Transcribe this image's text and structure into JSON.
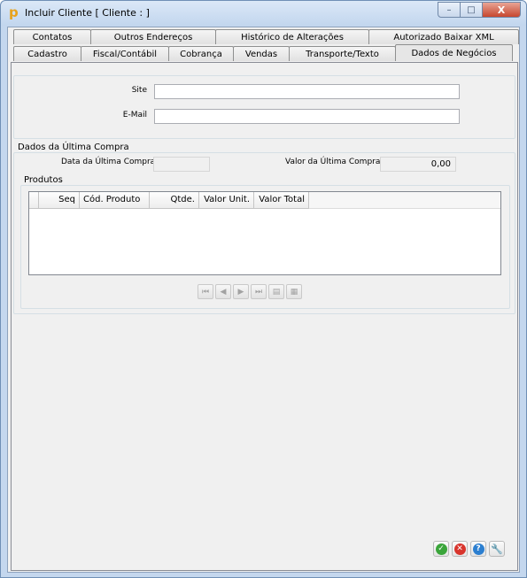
{
  "window": {
    "title": "Incluir Cliente [ Cliente : ]",
    "icon": "app-p-icon",
    "controls": {
      "minimize": "–",
      "maximize": "□",
      "close": "X"
    }
  },
  "tabs": {
    "row_top": [
      {
        "label": "Contatos"
      },
      {
        "label": "Outros Endereços"
      },
      {
        "label": "Histórico de Alterações"
      },
      {
        "label": "Autorizado Baixar XML"
      }
    ],
    "row_bottom": [
      {
        "label": "Cadastro"
      },
      {
        "label": "Fiscal/Contábil"
      },
      {
        "label": "Cobrança"
      },
      {
        "label": "Vendas"
      },
      {
        "label": "Transporte/Texto"
      },
      {
        "label": "Dados de Negócios",
        "active": true
      }
    ]
  },
  "form": {
    "site_label": "Site",
    "site_value": "",
    "email_label": "E-Mail",
    "email_value": ""
  },
  "last_purchase": {
    "section_title": "Dados da Última Compra",
    "date_label": "Data da Última Compra",
    "date_value": "",
    "value_label": "Valor da Última Compra",
    "value_value": "0,00",
    "products_title": "Produtos",
    "columns": [
      "Seq",
      "Cód. Produto",
      "Qtde.",
      "Valor Unit.",
      "Valor Total"
    ],
    "rows": []
  },
  "navigator": {
    "buttons": [
      "first-icon",
      "prior-icon",
      "next-icon",
      "last-icon",
      "edit-icon",
      "refresh-icon"
    ],
    "glyphs": [
      "⏮",
      "◀",
      "▶",
      "⏭",
      "▤",
      "▦"
    ]
  },
  "actions": [
    {
      "name": "confirm-button",
      "icon": "check-icon",
      "glyph": "✓",
      "color": "#3aa53a"
    },
    {
      "name": "cancel-button",
      "icon": "cancel-icon",
      "glyph": "✕",
      "color": "#d8342c"
    },
    {
      "name": "help-button",
      "icon": "help-icon",
      "glyph": "?",
      "color": "#2c7fd0"
    },
    {
      "name": "tools-button",
      "icon": "wrench-icon",
      "glyph": "🔧",
      "color": "#e4932c"
    }
  ],
  "colors": {
    "accent": "#c4d7ee",
    "panel": "#f0f0f0"
  }
}
